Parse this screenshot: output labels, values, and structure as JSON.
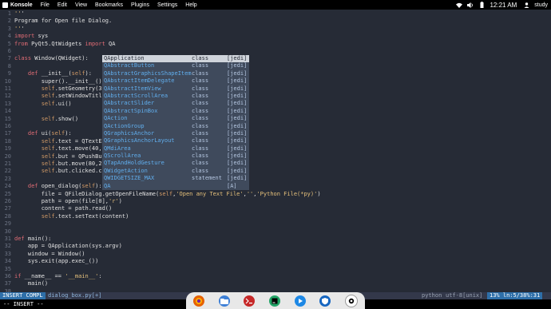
{
  "topbar": {
    "app_name": "Konsole",
    "menus": [
      "File",
      "Edit",
      "View",
      "Bookmarks",
      "Plugins",
      "Settings",
      "Help"
    ],
    "clock": "12:21 AM",
    "user": "study"
  },
  "editor": {
    "lines": [
      {
        "n": "1",
        "t": "'''"
      },
      {
        "n": "2",
        "t": "Program for Open file Dialog."
      },
      {
        "n": "3",
        "t": "'''"
      },
      {
        "n": "4",
        "t": "import sys"
      },
      {
        "n": "5",
        "t": "from PyQt5.QtWidgets import QA"
      },
      {
        "n": "6",
        "t": ""
      },
      {
        "n": "7",
        "t": "class Window(QWidget):"
      },
      {
        "n": "8",
        "t": ""
      },
      {
        "n": "9",
        "t": "    def __init__(self):"
      },
      {
        "n": "10",
        "t": "        super().__init__()"
      },
      {
        "n": "11",
        "t": "        self.setGeometry(30"
      },
      {
        "n": "12",
        "t": "        self.setWindowTitle"
      },
      {
        "n": "13",
        "t": "        self.ui()"
      },
      {
        "n": "14",
        "t": ""
      },
      {
        "n": "15",
        "t": "        self.show()"
      },
      {
        "n": "16",
        "t": ""
      },
      {
        "n": "17",
        "t": "    def ui(self):"
      },
      {
        "n": "18",
        "t": "        self.text = QTextEd"
      },
      {
        "n": "19",
        "t": "        self.text.move(40,1"
      },
      {
        "n": "20",
        "t": "        self.but = QPushBut"
      },
      {
        "n": "21",
        "t": "        self.but.move(80,25"
      },
      {
        "n": "22",
        "t": "        self.but.clicked.co"
      },
      {
        "n": "23",
        "t": ""
      },
      {
        "n": "24",
        "t": "    def open_dialog(self):"
      },
      {
        "n": "25",
        "t": "        file = QFileDialog.getOpenFileName(self,'Open any Text File','','Python File(*py)')"
      },
      {
        "n": "26",
        "t": "        path = open(file[0],'r')"
      },
      {
        "n": "27",
        "t": "        content = path.read()"
      },
      {
        "n": "28",
        "t": "        self.text.setText(content)"
      },
      {
        "n": "29",
        "t": ""
      },
      {
        "n": "30",
        "t": ""
      },
      {
        "n": "31",
        "t": "def main():"
      },
      {
        "n": "32",
        "t": "    app = QApplication(sys.argv)"
      },
      {
        "n": "33",
        "t": "    window = Window()"
      },
      {
        "n": "34",
        "t": "    sys.exit(app.exec_())"
      },
      {
        "n": "35",
        "t": ""
      },
      {
        "n": "36",
        "t": "if __name__ == '__main__':"
      },
      {
        "n": "37",
        "t": "    main()"
      },
      {
        "n": "38",
        "t": ""
      }
    ]
  },
  "autocomplete": {
    "items": [
      {
        "name": "QApplication",
        "kind": "class",
        "src": "[jedi]"
      },
      {
        "name": "QAbstractButton",
        "kind": "class",
        "src": "[jedi]"
      },
      {
        "name": "QAbstractGraphicsShapeItem",
        "kind": "class",
        "src": "[jedi]"
      },
      {
        "name": "QAbstractItemDelegate",
        "kind": "class",
        "src": "[jedi]"
      },
      {
        "name": "QAbstractItemView",
        "kind": "class",
        "src": "[jedi]"
      },
      {
        "name": "QAbstractScrollArea",
        "kind": "class",
        "src": "[jedi]"
      },
      {
        "name": "QAbstractSlider",
        "kind": "class",
        "src": "[jedi]"
      },
      {
        "name": "QAbstractSpinBox",
        "kind": "class",
        "src": "[jedi]"
      },
      {
        "name": "QAction",
        "kind": "class",
        "src": "[jedi]"
      },
      {
        "name": "QActionGroup",
        "kind": "class",
        "src": "[jedi]"
      },
      {
        "name": "QGraphicsAnchor",
        "kind": "class",
        "src": "[jedi]"
      },
      {
        "name": "QGraphicsAnchorLayout",
        "kind": "class",
        "src": "[jedi]"
      },
      {
        "name": "QMdiArea",
        "kind": "class",
        "src": "[jedi]"
      },
      {
        "name": "QScrollArea",
        "kind": "class",
        "src": "[jedi]"
      },
      {
        "name": "QTapAndHoldGesture",
        "kind": "class",
        "src": "[jedi]"
      },
      {
        "name": "QWidgetAction",
        "kind": "class",
        "src": "[jedi]"
      },
      {
        "name": "QWIDGETSIZE_MAX",
        "kind": "statement",
        "src": "[jedi]"
      },
      {
        "name": "QA",
        "kind": "",
        "src": "[A]"
      }
    ]
  },
  "statusline": {
    "mode": "INSERT COMPL",
    "filename": "dialog_box.py[+]",
    "filetype": "python",
    "encoding": "utf-8[unix]",
    "position": "13% ln:5/38%:31"
  },
  "cmdline": {
    "mode_text": "-- INSERT --"
  },
  "dock": {
    "icons": [
      "firefox-icon",
      "files-icon",
      "terminal-icon",
      "pycharm-icon",
      "kodi-icon",
      "vpn-icon",
      "apps-icon"
    ]
  },
  "colors": {
    "editor_bg": "#262b36",
    "popup_bg": "#3f4a5c",
    "popup_selected": "#cfd4db",
    "accent": "#2e6fa9"
  }
}
